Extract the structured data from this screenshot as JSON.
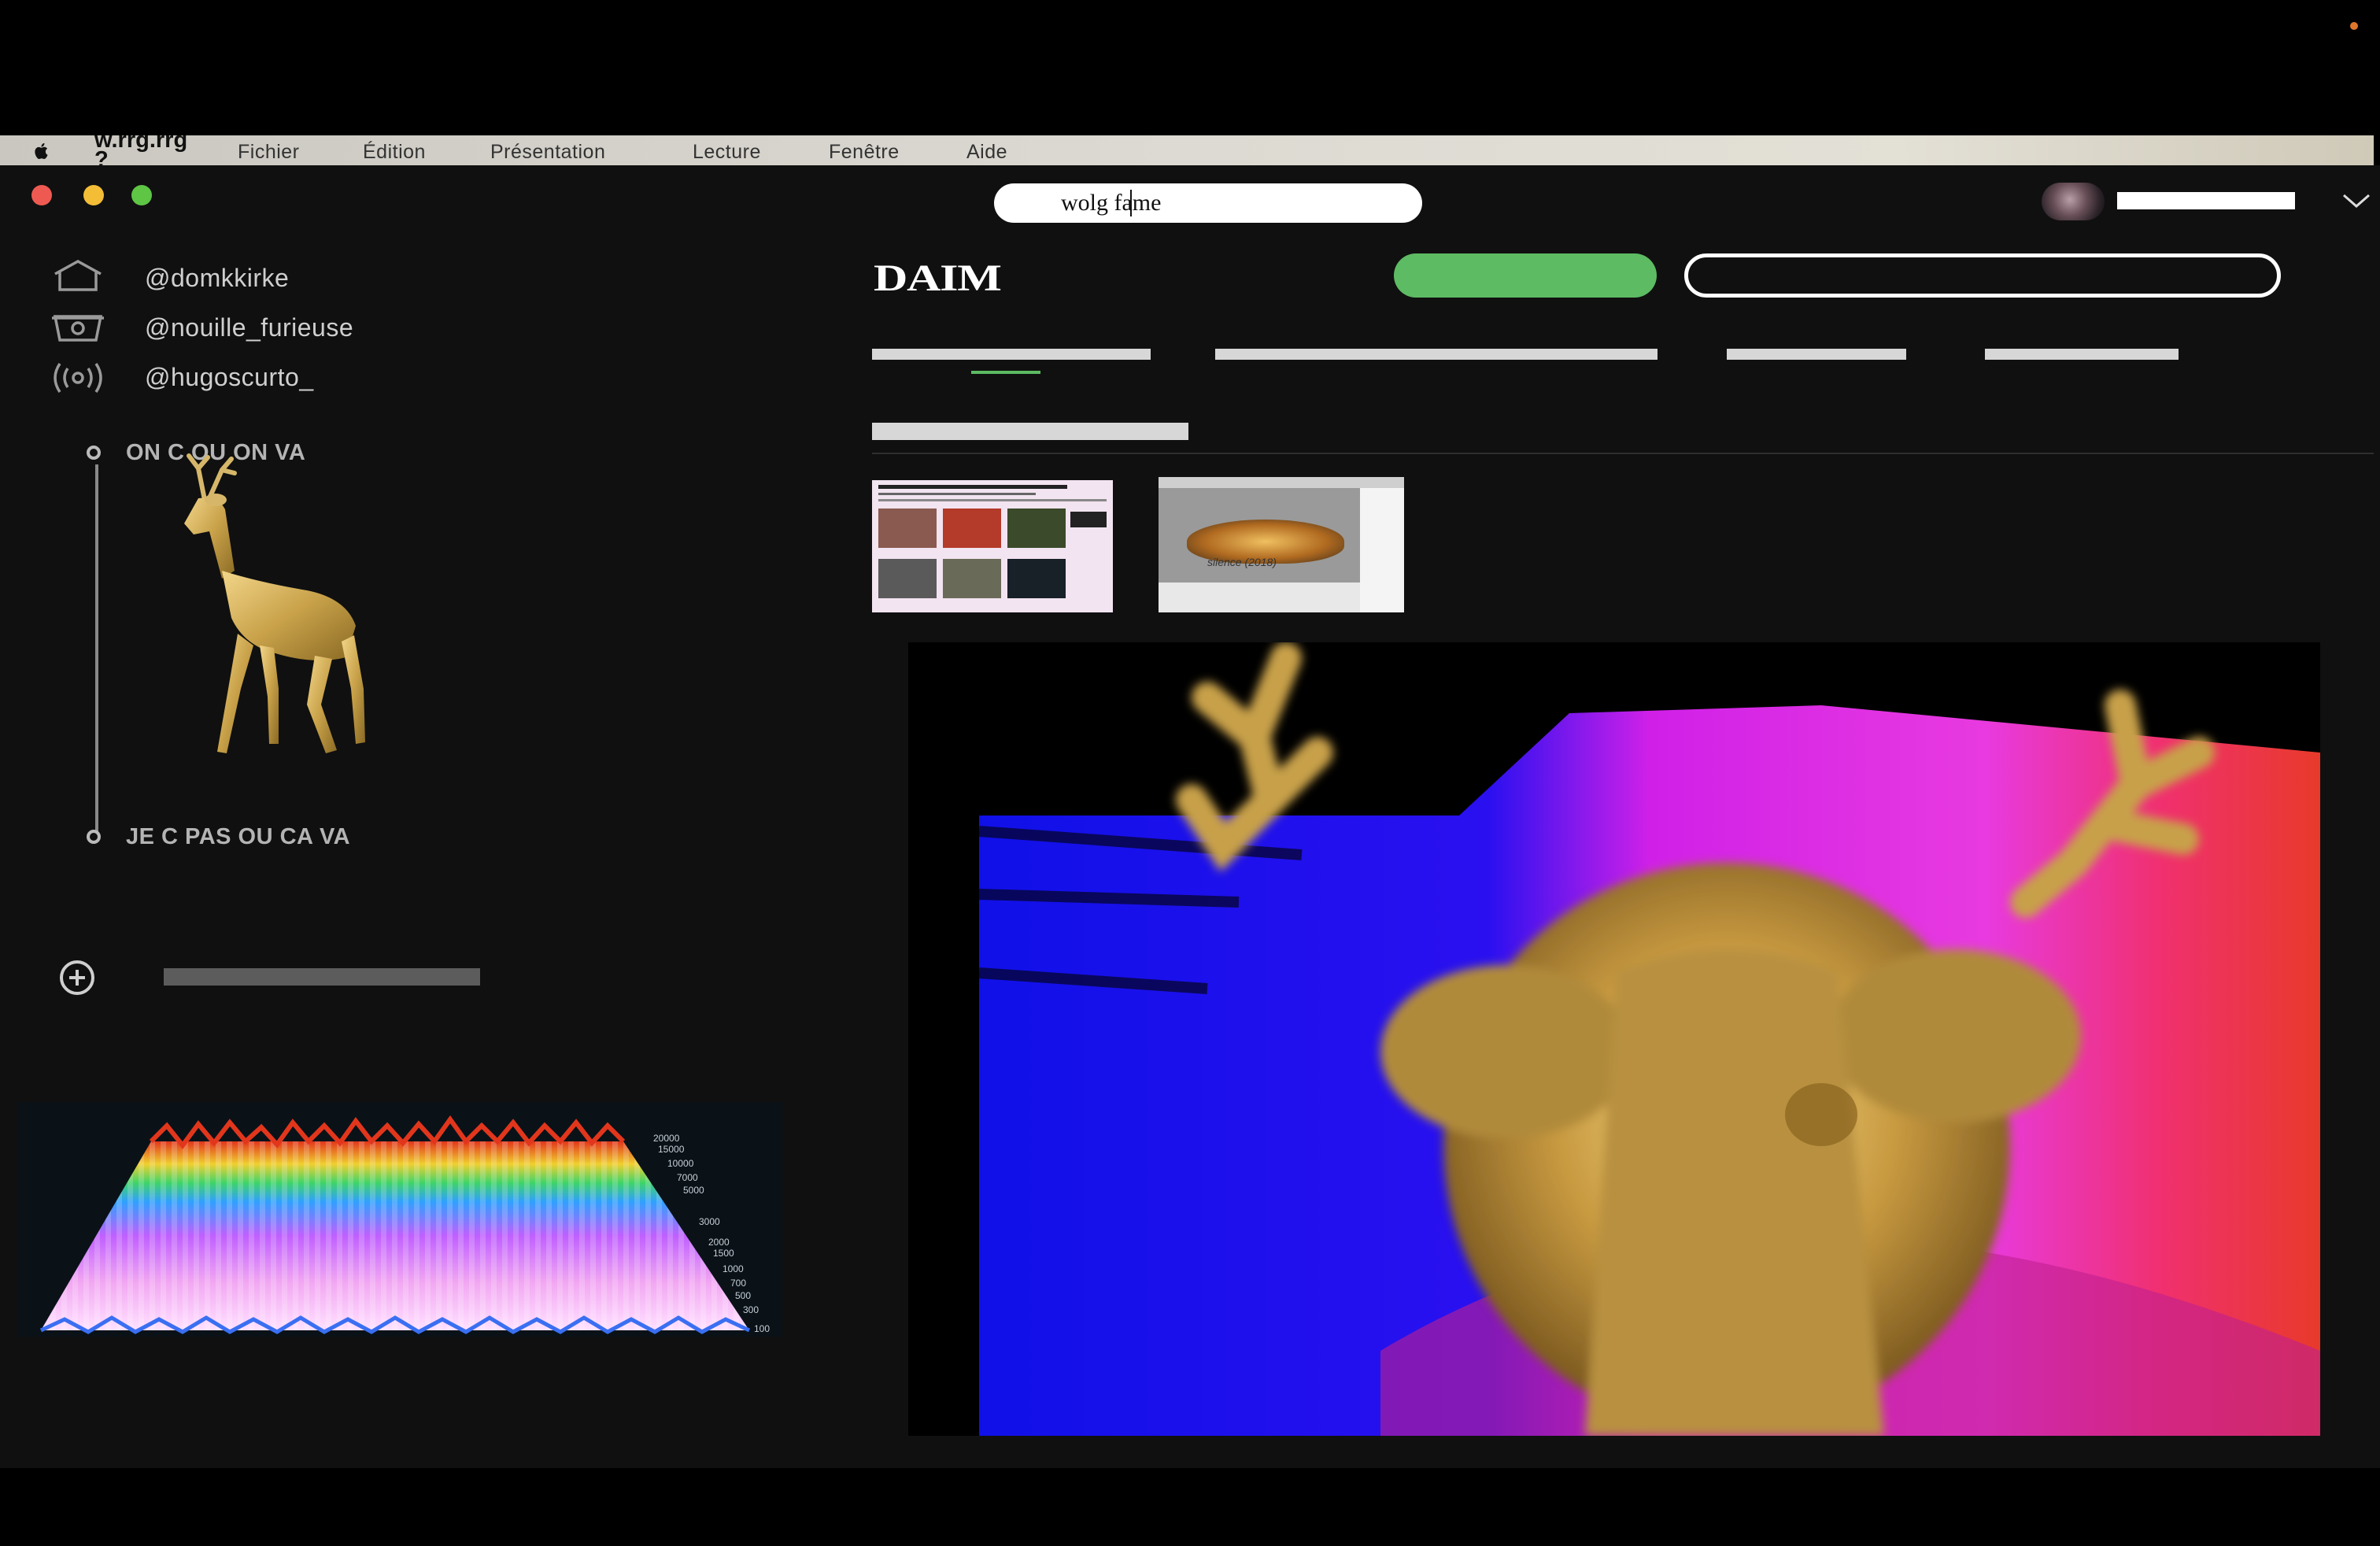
{
  "menubar": {
    "app_name": "w.rrg.rrg\n?",
    "items": [
      "Fichier",
      "Édition",
      "Présentation",
      "Lecture",
      "Fenêtre",
      "Aide"
    ]
  },
  "window": {
    "traffic_colors": [
      "#ee5a52",
      "#f3bd36",
      "#5ec545"
    ],
    "search_value": "wolg fame"
  },
  "sidebar": {
    "handles": [
      "@domkkirke",
      "@nouille_furieuse",
      "@hugoscurto_"
    ],
    "icons": [
      "home-icon",
      "camera-icon",
      "broadcast-icon"
    ],
    "timeline": {
      "top_label": "ON C OU ON VA",
      "bottom_label": "JE C PAS OU CA VA"
    },
    "spectrogram_labels": [
      "20000",
      "15000",
      "10000",
      "7000",
      "5000",
      "3000",
      "2000",
      "1500",
      "1000",
      "700",
      "500",
      "300",
      "100"
    ]
  },
  "main": {
    "brand": "DAIM",
    "accent_color": "#5dbb63",
    "thumb2_caption": "silence (2018)"
  }
}
